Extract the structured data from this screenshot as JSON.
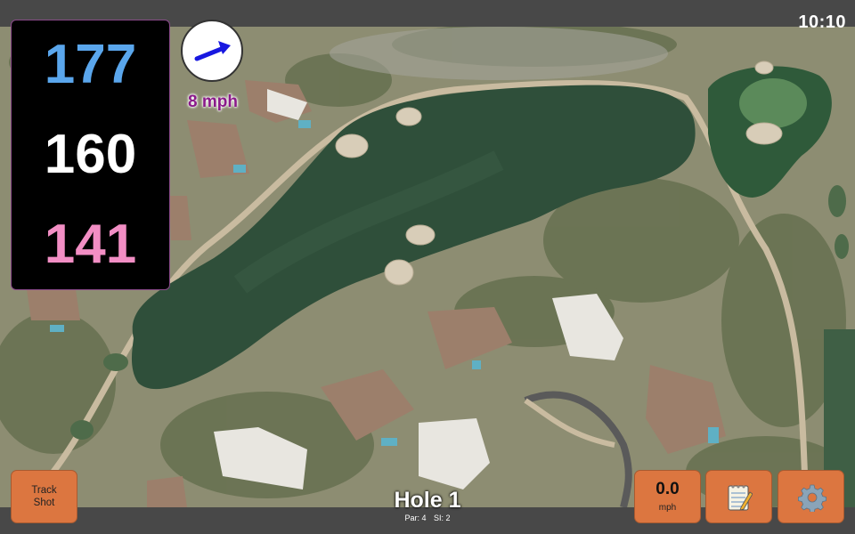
{
  "status": {
    "time": "10:10"
  },
  "yardages": {
    "back": "177",
    "center": "160",
    "front": "141"
  },
  "wind": {
    "speed_label": "8 mph",
    "icon": "wind-direction-arrow-icon"
  },
  "hole": {
    "title": "Hole 1",
    "par_label": "Par: 4",
    "si_label": "SI: 2"
  },
  "buttons": {
    "track_shot": {
      "line1": "Track",
      "line2": "Shot"
    },
    "speed": {
      "value": "0.0",
      "unit": "mph"
    },
    "notes": {
      "icon": "notepad-icon"
    },
    "settings": {
      "icon": "gear-icon"
    }
  },
  "colors": {
    "back_distance": "#5aa6ec",
    "center_distance": "#ffffff",
    "front_distance": "#f28ec4",
    "button_orange": "#dc7640",
    "wind_label": "#8a1a8a"
  }
}
